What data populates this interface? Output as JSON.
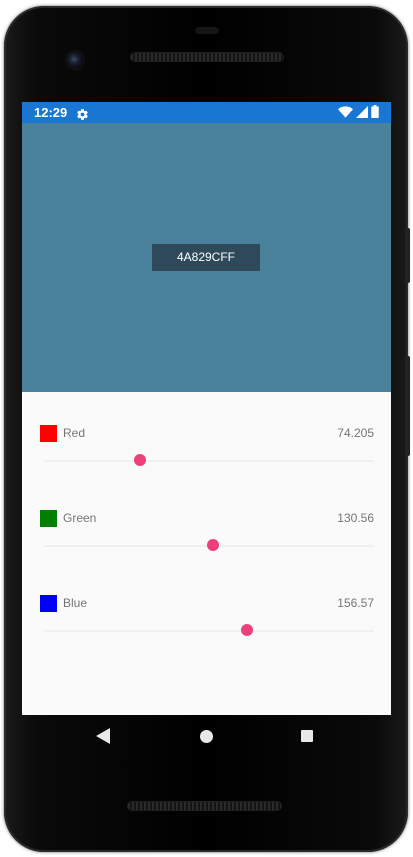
{
  "status_bar": {
    "time": "12:29",
    "icons": [
      "settings-icon",
      "wifi-icon",
      "signal-icon",
      "battery-icon"
    ]
  },
  "preview": {
    "color": "#4a829c",
    "hex_label": "4A829CFF"
  },
  "channels": [
    {
      "name": "Red",
      "value": "74.205",
      "fraction": 0.291,
      "swatch": "#ff0000"
    },
    {
      "name": "Green",
      "value": "130.56",
      "fraction": 0.512,
      "swatch": "#008000"
    },
    {
      "name": "Blue",
      "value": "156.57",
      "fraction": 0.614,
      "swatch": "#0000ff"
    }
  ],
  "colors": {
    "status_bar": "#1976d2",
    "slider_thumb": "#ec407a"
  },
  "nav_bar": {
    "icons": [
      "back-icon",
      "home-icon",
      "recent-apps-icon"
    ]
  }
}
